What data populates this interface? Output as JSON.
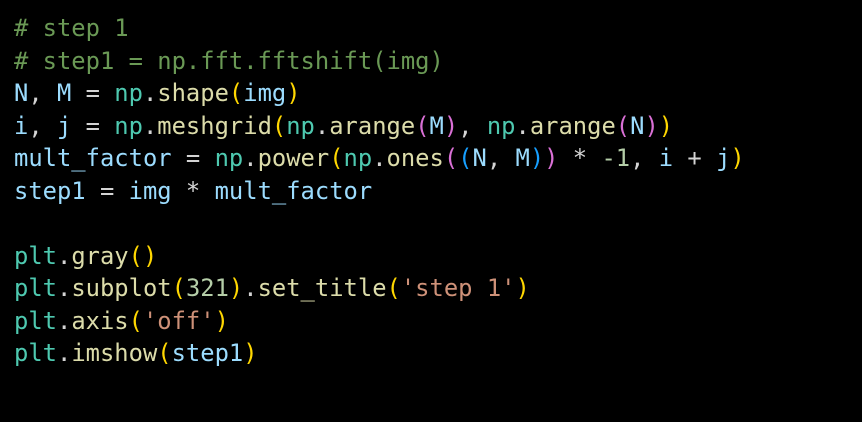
{
  "code": {
    "lines": [
      [
        {
          "t": "# step 1",
          "c": "comment"
        }
      ],
      [
        {
          "t": "# step1 = np.fft.fftshift(img)",
          "c": "comment"
        }
      ],
      [
        {
          "t": "N",
          "c": "var"
        },
        {
          "t": ", ",
          "c": "op"
        },
        {
          "t": "M",
          "c": "var"
        },
        {
          "t": " = ",
          "c": "op"
        },
        {
          "t": "np",
          "c": "mod"
        },
        {
          "t": ".",
          "c": "op"
        },
        {
          "t": "shape",
          "c": "func"
        },
        {
          "t": "(",
          "c": "p1"
        },
        {
          "t": "img",
          "c": "var"
        },
        {
          "t": ")",
          "c": "p1"
        }
      ],
      [
        {
          "t": "i",
          "c": "var"
        },
        {
          "t": ", ",
          "c": "op"
        },
        {
          "t": "j",
          "c": "var"
        },
        {
          "t": " = ",
          "c": "op"
        },
        {
          "t": "np",
          "c": "mod"
        },
        {
          "t": ".",
          "c": "op"
        },
        {
          "t": "meshgrid",
          "c": "func"
        },
        {
          "t": "(",
          "c": "p1"
        },
        {
          "t": "np",
          "c": "mod"
        },
        {
          "t": ".",
          "c": "op"
        },
        {
          "t": "arange",
          "c": "func"
        },
        {
          "t": "(",
          "c": "p2"
        },
        {
          "t": "M",
          "c": "var"
        },
        {
          "t": ")",
          "c": "p2"
        },
        {
          "t": ", ",
          "c": "op"
        },
        {
          "t": "np",
          "c": "mod"
        },
        {
          "t": ".",
          "c": "op"
        },
        {
          "t": "arange",
          "c": "func"
        },
        {
          "t": "(",
          "c": "p2"
        },
        {
          "t": "N",
          "c": "var"
        },
        {
          "t": ")",
          "c": "p2"
        },
        {
          "t": ")",
          "c": "p1"
        }
      ],
      [
        {
          "t": "mult_factor",
          "c": "var"
        },
        {
          "t": " = ",
          "c": "op"
        },
        {
          "t": "np",
          "c": "mod"
        },
        {
          "t": ".",
          "c": "op"
        },
        {
          "t": "power",
          "c": "func"
        },
        {
          "t": "(",
          "c": "p1"
        },
        {
          "t": "np",
          "c": "mod"
        },
        {
          "t": ".",
          "c": "op"
        },
        {
          "t": "ones",
          "c": "func"
        },
        {
          "t": "(",
          "c": "p2"
        },
        {
          "t": "(",
          "c": "p3"
        },
        {
          "t": "N",
          "c": "var"
        },
        {
          "t": ", ",
          "c": "op"
        },
        {
          "t": "M",
          "c": "var"
        },
        {
          "t": ")",
          "c": "p3"
        },
        {
          "t": ")",
          "c": "p2"
        },
        {
          "t": " * ",
          "c": "op"
        },
        {
          "t": "-1",
          "c": "num"
        },
        {
          "t": ", ",
          "c": "op"
        },
        {
          "t": "i",
          "c": "var"
        },
        {
          "t": " + ",
          "c": "op"
        },
        {
          "t": "j",
          "c": "var"
        },
        {
          "t": ")",
          "c": "p1"
        }
      ],
      [
        {
          "t": "step1",
          "c": "var"
        },
        {
          "t": " = ",
          "c": "op"
        },
        {
          "t": "img",
          "c": "var"
        },
        {
          "t": " * ",
          "c": "op"
        },
        {
          "t": "mult_factor",
          "c": "var"
        }
      ],
      [],
      [
        {
          "t": "plt",
          "c": "mod"
        },
        {
          "t": ".",
          "c": "op"
        },
        {
          "t": "gray",
          "c": "func"
        },
        {
          "t": "(",
          "c": "p1"
        },
        {
          "t": ")",
          "c": "p1"
        }
      ],
      [
        {
          "t": "plt",
          "c": "mod"
        },
        {
          "t": ".",
          "c": "op"
        },
        {
          "t": "subplot",
          "c": "func"
        },
        {
          "t": "(",
          "c": "p1"
        },
        {
          "t": "321",
          "c": "num"
        },
        {
          "t": ")",
          "c": "p1"
        },
        {
          "t": ".",
          "c": "op"
        },
        {
          "t": "set_title",
          "c": "func"
        },
        {
          "t": "(",
          "c": "p1"
        },
        {
          "t": "'step 1'",
          "c": "str"
        },
        {
          "t": ")",
          "c": "p1"
        }
      ],
      [
        {
          "t": "plt",
          "c": "mod"
        },
        {
          "t": ".",
          "c": "op"
        },
        {
          "t": "axis",
          "c": "func"
        },
        {
          "t": "(",
          "c": "p1"
        },
        {
          "t": "'off'",
          "c": "str"
        },
        {
          "t": ")",
          "c": "p1"
        }
      ],
      [
        {
          "t": "plt",
          "c": "mod"
        },
        {
          "t": ".",
          "c": "op"
        },
        {
          "t": "imshow",
          "c": "func"
        },
        {
          "t": "(",
          "c": "p1"
        },
        {
          "t": "step1",
          "c": "var"
        },
        {
          "t": ")",
          "c": "p1"
        }
      ]
    ]
  },
  "colors": {
    "background": "#000000",
    "comment": "#6a9955",
    "variable": "#9cdcfe",
    "operator": "#d4d4d4",
    "module": "#4ec9b0",
    "function": "#dcdcaa",
    "string": "#ce9178",
    "number": "#b5cea8",
    "bracket_level_1": "#ffd700",
    "bracket_level_2": "#da70d6",
    "bracket_level_3": "#179fff"
  }
}
